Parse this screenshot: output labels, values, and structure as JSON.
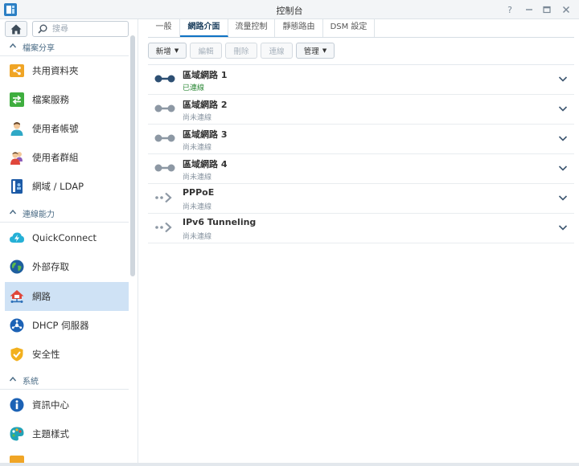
{
  "window": {
    "title": "控制台"
  },
  "sidebar": {
    "search_placeholder": "搜尋",
    "sections": [
      {
        "label": "檔案分享"
      },
      {
        "label": "連線能力"
      },
      {
        "label": "系統"
      }
    ],
    "items": [
      {
        "label": "共用資料夾"
      },
      {
        "label": "檔案服務"
      },
      {
        "label": "使用者帳號"
      },
      {
        "label": "使用者群組"
      },
      {
        "label": "網域 / LDAP"
      },
      {
        "label": "QuickConnect"
      },
      {
        "label": "外部存取"
      },
      {
        "label": "網路"
      },
      {
        "label": "DHCP 伺服器"
      },
      {
        "label": "安全性"
      },
      {
        "label": "資訊中心"
      },
      {
        "label": "主題樣式"
      }
    ]
  },
  "tabs": [
    {
      "label": "一般"
    },
    {
      "label": "網路介面"
    },
    {
      "label": "流量控制"
    },
    {
      "label": "靜態路由"
    },
    {
      "label": "DSM 設定"
    }
  ],
  "toolbar": {
    "create": "新增",
    "edit": "編輯",
    "delete": "刪除",
    "connect": "連線",
    "manage": "管理"
  },
  "interfaces": [
    {
      "name": "區域網路 1",
      "status": "已連線"
    },
    {
      "name": "區域網路 2",
      "status": "尚未連線"
    },
    {
      "name": "區域網路 3",
      "status": "尚未連線"
    },
    {
      "name": "區域網路 4",
      "status": "尚未連線"
    },
    {
      "name": "PPPoE",
      "status": "尚未連線"
    },
    {
      "name": "IPv6 Tunneling",
      "status": "尚未連線"
    }
  ],
  "colors": {
    "accent": "#0e73c4",
    "active_item_bg": "#cfe2f5",
    "connected": "#2f8a3a"
  }
}
